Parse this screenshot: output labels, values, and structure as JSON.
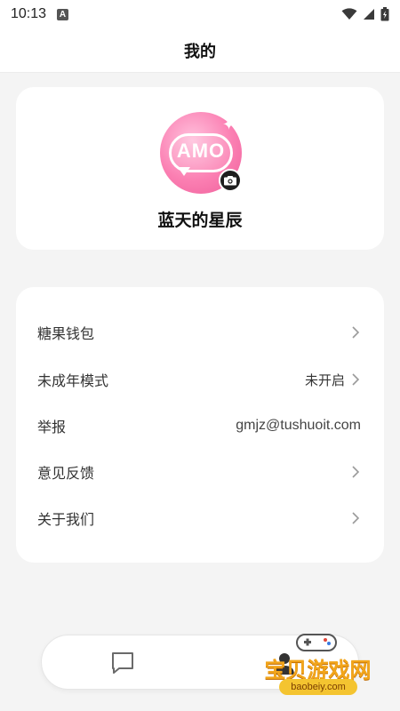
{
  "status_bar": {
    "time": "10:13",
    "notif_letter": "A"
  },
  "header": {
    "title": "我的"
  },
  "profile": {
    "avatar_text": "AMO",
    "username": "蓝天的星辰"
  },
  "menu": {
    "items": [
      {
        "label": "糖果钱包",
        "value": "",
        "chevron": true
      },
      {
        "label": "未成年模式",
        "value": "未开启",
        "chevron": true
      },
      {
        "label": "举报",
        "value": "gmjz@tushuoit.com",
        "chevron": false
      },
      {
        "label": "意见反馈",
        "value": "",
        "chevron": true
      },
      {
        "label": "关于我们",
        "value": "",
        "chevron": true
      }
    ]
  },
  "watermark": {
    "title": "宝贝游戏网",
    "url": "baobeiy.com"
  },
  "colors": {
    "background": "#f4f4f4",
    "card": "#ffffff",
    "avatar_pink": "#fb7fb2",
    "watermark_orange": "#f2a51b"
  }
}
